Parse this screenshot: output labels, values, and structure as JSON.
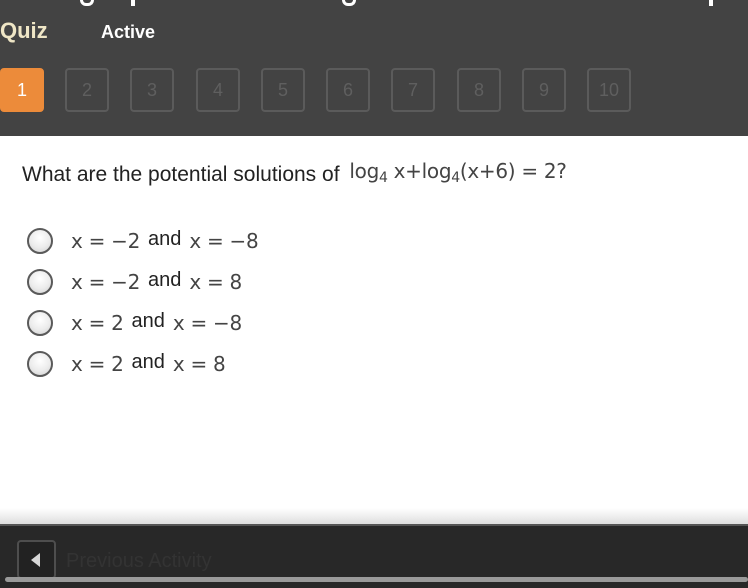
{
  "header": {
    "section_label": "Quiz",
    "status_label": "Active",
    "accent_color": "#ec8b3a",
    "question_nav": {
      "current": 1,
      "items": [
        "1",
        "2",
        "3",
        "4",
        "5",
        "6",
        "7",
        "8",
        "9",
        "10"
      ]
    }
  },
  "question": {
    "prompt": "What are the potential solutions of",
    "equation": {
      "log1": "log",
      "base1": "4",
      "arg1": "x+",
      "log2": "log",
      "base2": "4",
      "arg2": "(x+6) = 2?"
    }
  },
  "options": [
    {
      "left": "x = −2",
      "conj": "and",
      "right": "x = −8",
      "selected": false
    },
    {
      "left": "x = −2",
      "conj": "and",
      "right": "x = 8",
      "selected": false
    },
    {
      "left": "x = 2",
      "conj": "and",
      "right": "x = −8",
      "selected": false
    },
    {
      "left": "x = 2",
      "conj": "and",
      "right": "x = 8",
      "selected": false
    }
  ],
  "footer": {
    "previous_label": "Previous Activity",
    "previous_icon": "triangle-left-icon"
  }
}
